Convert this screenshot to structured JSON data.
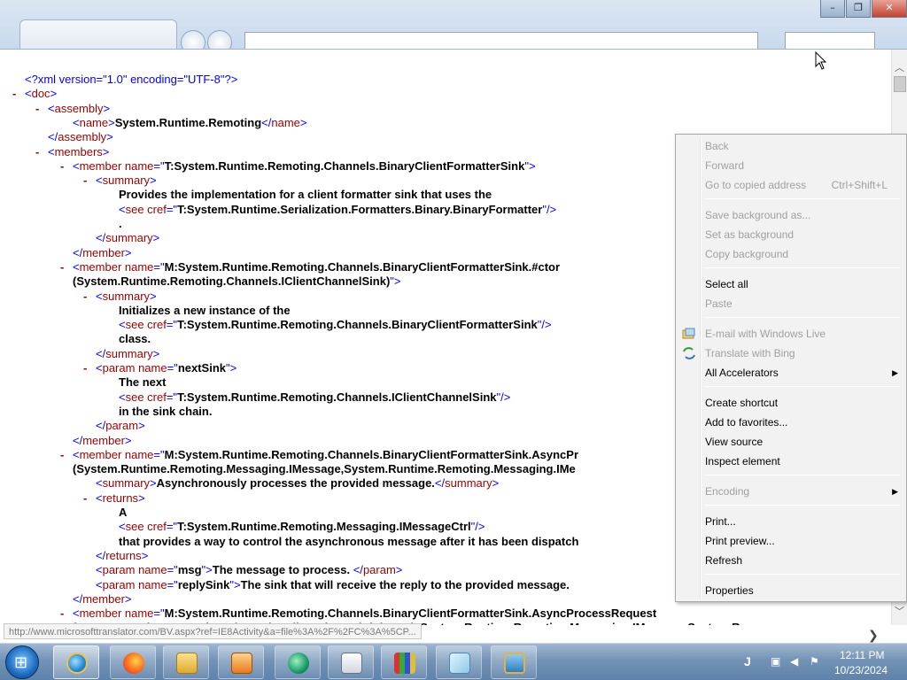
{
  "xml_lines": [
    [
      {
        "t": "<?xml version=\"1.0\" encoding=\"UTF-8\"?>",
        "c": "pi"
      }
    ],
    [
      {
        "t": "<",
        "c": "bl"
      },
      {
        "t": "doc",
        "c": "nm"
      },
      {
        "t": ">",
        "c": "bl"
      }
    ],
    [
      {
        "t": "<",
        "c": "bl"
      },
      {
        "t": "assembly",
        "c": "nm"
      },
      {
        "t": ">",
        "c": "bl"
      }
    ],
    [
      {
        "t": "<",
        "c": "bl"
      },
      {
        "t": "name",
        "c": "nm"
      },
      {
        "t": ">",
        "c": "bl"
      },
      {
        "t": "System.Runtime.Remoting",
        "c": "tx"
      },
      {
        "t": "</",
        "c": "bl"
      },
      {
        "t": "name",
        "c": "nm"
      },
      {
        "t": ">",
        "c": "bl"
      }
    ],
    [
      {
        "t": "</",
        "c": "bl"
      },
      {
        "t": "assembly",
        "c": "nm"
      },
      {
        "t": ">",
        "c": "bl"
      }
    ],
    [
      {
        "t": "<",
        "c": "bl"
      },
      {
        "t": "members",
        "c": "nm"
      },
      {
        "t": ">",
        "c": "bl"
      }
    ],
    [
      {
        "t": "<",
        "c": "bl"
      },
      {
        "t": "member ",
        "c": "nm"
      },
      {
        "t": "name",
        "c": "an"
      },
      {
        "t": "=\"",
        "c": "bl"
      },
      {
        "t": "T:System.Runtime.Remoting.Channels.BinaryClientFormatterSink",
        "c": "av"
      },
      {
        "t": "\">",
        "c": "bl"
      }
    ],
    [
      {
        "t": "<",
        "c": "bl"
      },
      {
        "t": "summary",
        "c": "nm"
      },
      {
        "t": ">",
        "c": "bl"
      }
    ],
    [
      {
        "t": "Provides the implementation for a client formatter sink that uses the",
        "c": "tx"
      }
    ],
    [
      {
        "t": "<",
        "c": "bl"
      },
      {
        "t": "see ",
        "c": "nm"
      },
      {
        "t": "cref",
        "c": "an"
      },
      {
        "t": "=\"",
        "c": "bl"
      },
      {
        "t": "T:System.Runtime.Serialization.Formatters.Binary.BinaryFormatter",
        "c": "av"
      },
      {
        "t": "\"/>",
        "c": "bl"
      }
    ],
    [
      {
        "t": ".",
        "c": "tx"
      }
    ],
    [
      {
        "t": "</",
        "c": "bl"
      },
      {
        "t": "summary",
        "c": "nm"
      },
      {
        "t": ">",
        "c": "bl"
      }
    ],
    [
      {
        "t": "</",
        "c": "bl"
      },
      {
        "t": "member",
        "c": "nm"
      },
      {
        "t": ">",
        "c": "bl"
      }
    ],
    [
      {
        "t": "<",
        "c": "bl"
      },
      {
        "t": "member ",
        "c": "nm"
      },
      {
        "t": "name",
        "c": "an"
      },
      {
        "t": "=\"",
        "c": "bl"
      },
      {
        "t": "M:System.Runtime.Remoting.Channels.BinaryClientFormatterSink.#ctor",
        "c": "av"
      }
    ],
    [
      {
        "t": "(System.Runtime.Remoting.Channels.IClientChannelSink)",
        "c": "av"
      },
      {
        "t": "\">",
        "c": "bl"
      }
    ],
    [
      {
        "t": "<",
        "c": "bl"
      },
      {
        "t": "summary",
        "c": "nm"
      },
      {
        "t": ">",
        "c": "bl"
      }
    ],
    [
      {
        "t": "Initializes a new instance of the",
        "c": "tx"
      }
    ],
    [
      {
        "t": "<",
        "c": "bl"
      },
      {
        "t": "see ",
        "c": "nm"
      },
      {
        "t": "cref",
        "c": "an"
      },
      {
        "t": "=\"",
        "c": "bl"
      },
      {
        "t": "T:System.Runtime.Remoting.Channels.BinaryClientFormatterSink",
        "c": "av"
      },
      {
        "t": "\"/>",
        "c": "bl"
      }
    ],
    [
      {
        "t": "class.",
        "c": "tx"
      }
    ],
    [
      {
        "t": "</",
        "c": "bl"
      },
      {
        "t": "summary",
        "c": "nm"
      },
      {
        "t": ">",
        "c": "bl"
      }
    ],
    [
      {
        "t": "<",
        "c": "bl"
      },
      {
        "t": "param ",
        "c": "nm"
      },
      {
        "t": "name",
        "c": "an"
      },
      {
        "t": "=\"",
        "c": "bl"
      },
      {
        "t": "nextSink",
        "c": "av"
      },
      {
        "t": "\">",
        "c": "bl"
      }
    ],
    [
      {
        "t": "The next",
        "c": "tx"
      }
    ],
    [
      {
        "t": "<",
        "c": "bl"
      },
      {
        "t": "see ",
        "c": "nm"
      },
      {
        "t": "cref",
        "c": "an"
      },
      {
        "t": "=\"",
        "c": "bl"
      },
      {
        "t": "T:System.Runtime.Remoting.Channels.IClientChannelSink",
        "c": "av"
      },
      {
        "t": "\"/>",
        "c": "bl"
      }
    ],
    [
      {
        "t": "in the sink chain.",
        "c": "tx"
      }
    ],
    [
      {
        "t": "</",
        "c": "bl"
      },
      {
        "t": "param",
        "c": "nm"
      },
      {
        "t": ">",
        "c": "bl"
      }
    ],
    [
      {
        "t": "</",
        "c": "bl"
      },
      {
        "t": "member",
        "c": "nm"
      },
      {
        "t": ">",
        "c": "bl"
      }
    ],
    [
      {
        "t": "<",
        "c": "bl"
      },
      {
        "t": "member ",
        "c": "nm"
      },
      {
        "t": "name",
        "c": "an"
      },
      {
        "t": "=\"",
        "c": "bl"
      },
      {
        "t": "M:System.Runtime.Remoting.Channels.BinaryClientFormatterSink.AsyncPr",
        "c": "av"
      }
    ],
    [
      {
        "t": "(System.Runtime.Remoting.Messaging.IMessage,System.Runtime.Remoting.Messaging.IMe",
        "c": "av"
      }
    ],
    [
      {
        "t": "<",
        "c": "bl"
      },
      {
        "t": "summary",
        "c": "nm"
      },
      {
        "t": ">",
        "c": "bl"
      },
      {
        "t": "Asynchronously processes the provided message.",
        "c": "tx"
      },
      {
        "t": "</",
        "c": "bl"
      },
      {
        "t": "summary",
        "c": "nm"
      },
      {
        "t": ">",
        "c": "bl"
      }
    ],
    [
      {
        "t": "<",
        "c": "bl"
      },
      {
        "t": "returns",
        "c": "nm"
      },
      {
        "t": ">",
        "c": "bl"
      }
    ],
    [
      {
        "t": "A",
        "c": "tx"
      }
    ],
    [
      {
        "t": "<",
        "c": "bl"
      },
      {
        "t": "see ",
        "c": "nm"
      },
      {
        "t": "cref",
        "c": "an"
      },
      {
        "t": "=\"",
        "c": "bl"
      },
      {
        "t": "T:System.Runtime.Remoting.Messaging.IMessageCtrl",
        "c": "av"
      },
      {
        "t": "\"/>",
        "c": "bl"
      }
    ],
    [
      {
        "t": "that provides a way to control the asynchronous message after it has been dispatch",
        "c": "tx"
      }
    ],
    [
      {
        "t": "</",
        "c": "bl"
      },
      {
        "t": "returns",
        "c": "nm"
      },
      {
        "t": ">",
        "c": "bl"
      }
    ],
    [
      {
        "t": "<",
        "c": "bl"
      },
      {
        "t": "param ",
        "c": "nm"
      },
      {
        "t": "name",
        "c": "an"
      },
      {
        "t": "=\"",
        "c": "bl"
      },
      {
        "t": "msg",
        "c": "av"
      },
      {
        "t": "\">",
        "c": "bl"
      },
      {
        "t": "The message to process. ",
        "c": "tx"
      },
      {
        "t": "</",
        "c": "bl"
      },
      {
        "t": "param",
        "c": "nm"
      },
      {
        "t": ">",
        "c": "bl"
      }
    ],
    [
      {
        "t": "<",
        "c": "bl"
      },
      {
        "t": "param ",
        "c": "nm"
      },
      {
        "t": "name",
        "c": "an"
      },
      {
        "t": "=\"",
        "c": "bl"
      },
      {
        "t": "replySink",
        "c": "av"
      },
      {
        "t": "\">",
        "c": "bl"
      },
      {
        "t": "The sink that will receive the reply to the provided message.",
        "c": "tx"
      }
    ],
    [
      {
        "t": "</",
        "c": "bl"
      },
      {
        "t": "member",
        "c": "nm"
      },
      {
        "t": ">",
        "c": "bl"
      }
    ],
    [
      {
        "t": "<",
        "c": "bl"
      },
      {
        "t": "member ",
        "c": "nm"
      },
      {
        "t": "name",
        "c": "an"
      },
      {
        "t": "=\"",
        "c": "bl"
      },
      {
        "t": "M:System.Runtime.Remoting.Channels.BinaryClientFormatterSink.AsyncProcessRequest",
        "c": "av"
      }
    ],
    [
      {
        "t": "(System.Runtime.Remoting.Channels.IClientChannelSinkStack,System.Runtime.Remoting.Messaging.IMessage,System.Run",
        "c": "av"
      }
    ]
  ],
  "toggle_symbol": "-",
  "status_url": "http://www.microsofttranslator.com/BV.aspx?ref=IE8Activity&a=file%3A%2F%2FC%3A%5CP...",
  "context_menu": {
    "back": "Back",
    "forward": "Forward",
    "go_copied": "Go to copied address",
    "go_copied_shortcut": "Ctrl+Shift+L",
    "save_bg": "Save background as...",
    "set_bg": "Set as background",
    "copy_bg": "Copy background",
    "select_all": "Select all",
    "paste": "Paste",
    "email_live": "E-mail with Windows Live",
    "translate_bing": "Translate with Bing",
    "all_accelerators": "All Accelerators",
    "create_shortcut": "Create shortcut",
    "add_favorites": "Add to favorites...",
    "view_source": "View source",
    "inspect_element": "Inspect element",
    "encoding": "Encoding",
    "print": "Print...",
    "print_preview": "Print preview...",
    "refresh": "Refresh",
    "properties": "Properties",
    "submenu_arrow": "▶"
  },
  "taskbar": {
    "ime": "J",
    "time": "12:11 PM",
    "date": "10/23/2024"
  },
  "window_controls": {
    "minimize": "–",
    "restore": "❐",
    "close": "✕"
  },
  "scroll_arrows": {
    "up": "︿",
    "down": "﹀",
    "right": "❯"
  },
  "colors": {
    "xml_tag": "#0000ff",
    "xml_name": "#990000",
    "xml_text": "#000000",
    "menu_disabled": "#a0a0a0"
  }
}
